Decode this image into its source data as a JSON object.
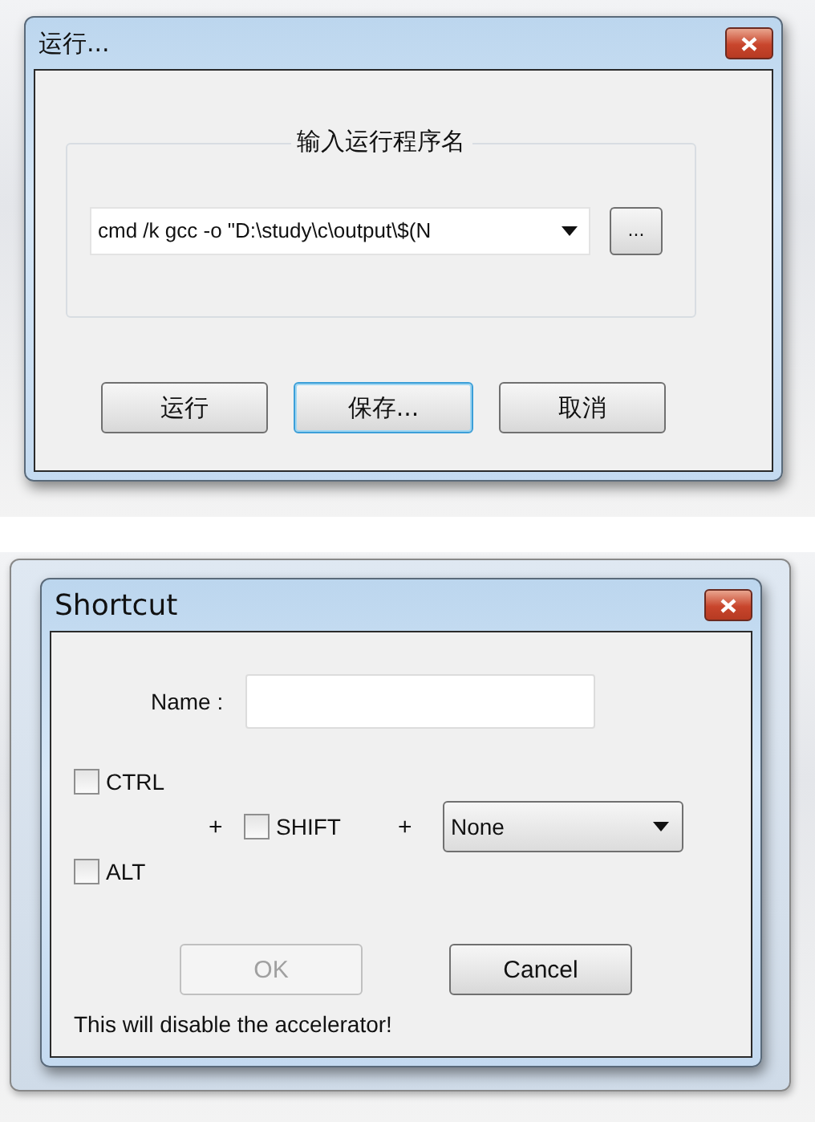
{
  "run_dialog": {
    "title": "运行...",
    "group": {
      "title": "输入运行程序名",
      "command": {
        "value": "cmd /k gcc -o \"D:\\study\\c\\output\\$(N"
      },
      "browse_button": "..."
    },
    "buttons": [
      {
        "label": "运行",
        "focused": false
      },
      {
        "label": "保存...",
        "focused": true
      },
      {
        "label": "取消",
        "focused": false
      }
    ]
  },
  "shortcut_dialog": {
    "title": "Shortcut",
    "name_label": "Name :",
    "modifiers": [
      {
        "label": "CTRL",
        "checked": false
      },
      {
        "label": "SHIFT",
        "checked": false
      },
      {
        "label": "ALT",
        "checked": false
      }
    ],
    "plus_signs": [
      "+",
      "+"
    ],
    "key_select": {
      "value": "None"
    },
    "buttons": [
      {
        "label": "OK",
        "disabled": true
      },
      {
        "label": "Cancel",
        "disabled": false
      }
    ],
    "message": "This will disable the accelerator!"
  }
}
